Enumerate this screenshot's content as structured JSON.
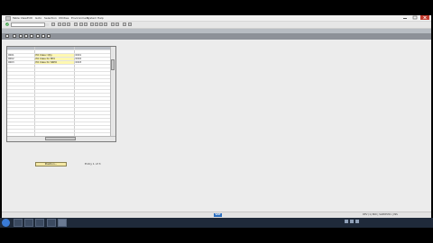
{
  "menu": {
    "items": [
      "Table View",
      "Edit",
      "Goto",
      "Selection",
      "Utilities",
      "Environment",
      "System",
      "Help"
    ]
  },
  "toolbar": {
    "command_placeholder": "",
    "icons": [
      "enter-icon",
      "save-icon",
      "back-icon",
      "exit-icon",
      "cancel-icon",
      "print-icon",
      "find-icon",
      "find-next-icon",
      "first-page-icon",
      "previous-page-icon",
      "next-page-icon",
      "last-page-icon",
      "create-session-icon",
      "shortcut-icon",
      "help-icon",
      "layout-icon"
    ]
  },
  "title_bar": {
    "title": ""
  },
  "app_toolbar": {
    "icons": [
      "display-change-icon",
      "new-entries-icon",
      "copy-icon",
      "delete-icon",
      "undo-icon",
      "select-all-icon",
      "select-block-icon",
      "deselect-all-icon"
    ]
  },
  "table": {
    "headers": [
      "",
      "",
      ""
    ],
    "rows": [
      {
        "key": "",
        "description": "",
        "flag": ""
      },
      {
        "key": "0001",
        "description": "PO Class I Qty",
        "flag": "0001"
      },
      {
        "key": "0002",
        "description": "PO Class for Mfd",
        "flag": "0002"
      },
      {
        "key": "0003",
        "description": "PO Class for SRPO",
        "flag": "0003"
      },
      {
        "key": "",
        "description": "",
        "flag": ""
      }
    ],
    "empty_rows": 23
  },
  "position_button": {
    "label": "Position..."
  },
  "entry_info": {
    "text": "Entry 1 of 3"
  },
  "status_bar": {
    "logo": "SAP",
    "system_info": "DEV (1) 800 | SAPDEV01 | INS"
  },
  "taskbar": {
    "clock_time": "",
    "clock_date": ""
  }
}
